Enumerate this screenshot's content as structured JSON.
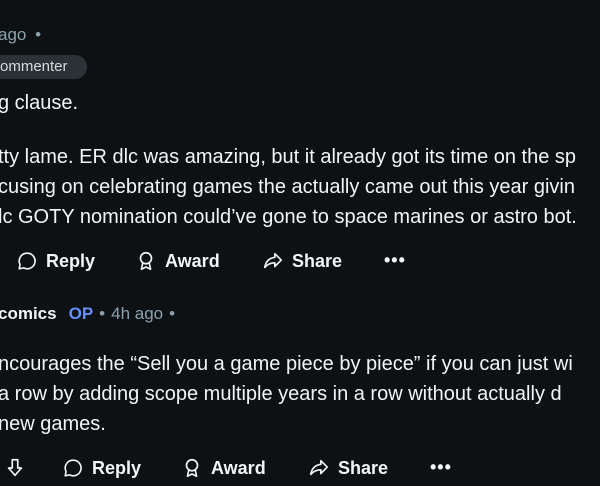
{
  "comment1": {
    "time": "ago",
    "dot": "•",
    "badge": "ommenter",
    "lines": [
      "g clause.",
      "tty lame. ER dlc was amazing, but it already got its time on the sp",
      "cusing on celebrating games the actually came out this year givin",
      "lc GOTY nomination could’ve gone to space marines or astro bot."
    ],
    "actions": {
      "reply": "Reply",
      "award": "Award",
      "share": "Share",
      "more": "•••"
    }
  },
  "comment2": {
    "username": "comics",
    "op": "OP",
    "dot1": "•",
    "time": "4h ago",
    "dot2": "•",
    "lines": [
      "ncourages the “Sell you a game piece by piece” if you can just wi",
      "a row by adding scope multiple years in a row without actually d",
      "new games."
    ],
    "actions": {
      "reply": "Reply",
      "award": "Award",
      "share": "Share",
      "more": "•••"
    }
  },
  "icons": [
    "comment-icon",
    "award-icon",
    "share-icon",
    "downvote-icon",
    "more-icon"
  ]
}
